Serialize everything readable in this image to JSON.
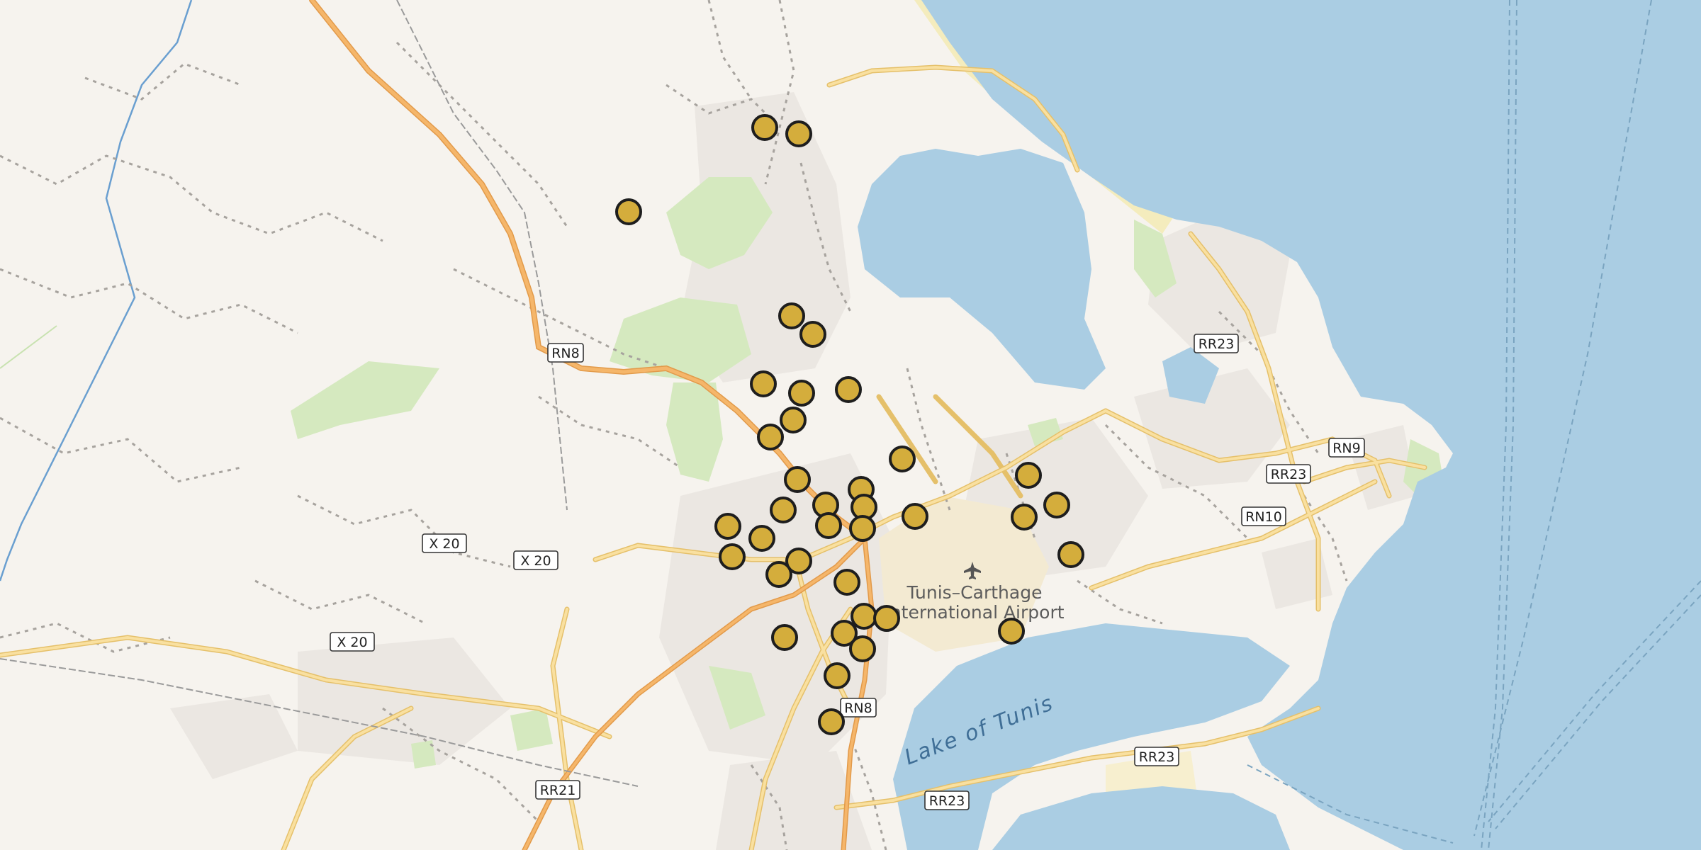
{
  "map": {
    "place_labels": {
      "airport_line1": "Tunis–Carthage",
      "airport_line2": "International Airport",
      "lake": "Lake of Tunis"
    },
    "road_labels": [
      {
        "id": "rn8-north",
        "text": "RN8"
      },
      {
        "id": "x20-a",
        "text": "X 20"
      },
      {
        "id": "x20-b",
        "text": "X 20"
      },
      {
        "id": "x20-c",
        "text": "X 20"
      },
      {
        "id": "rr23-north",
        "text": "RR23"
      },
      {
        "id": "rn9",
        "text": "RN9"
      },
      {
        "id": "rr23-mid",
        "text": "RR23"
      },
      {
        "id": "rn10",
        "text": "RN10"
      },
      {
        "id": "rn8-south",
        "text": "RN8"
      },
      {
        "id": "rr21",
        "text": "RR21"
      },
      {
        "id": "rr23-south-a",
        "text": "RR23"
      },
      {
        "id": "rr23-south-b",
        "text": "RR23"
      }
    ],
    "marker_count": 36,
    "colors": {
      "water": "#aacde3",
      "land": "#f6f3ee",
      "park": "#d5e9bf",
      "road": "#f7d67c",
      "highway": "#f5b66a",
      "marker_fill": "#d4ad3c",
      "marker_stroke": "#1e1e1e"
    },
    "icons": [
      "airport-icon"
    ]
  }
}
